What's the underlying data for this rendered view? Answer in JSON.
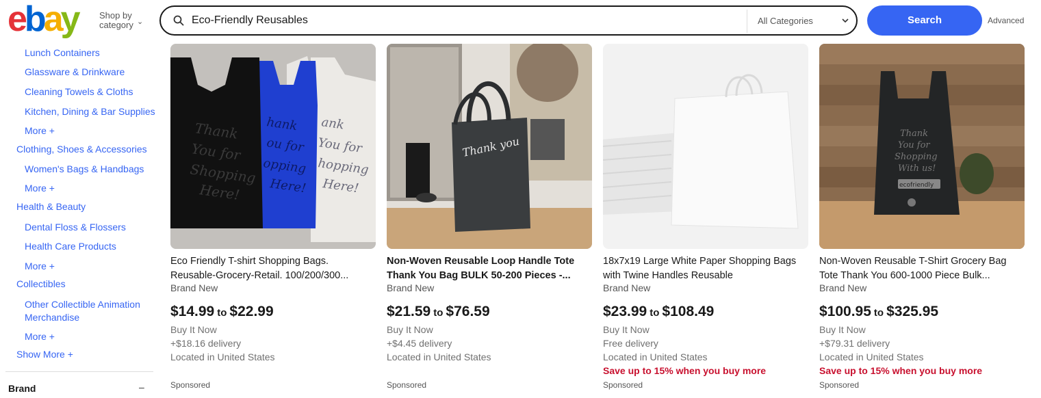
{
  "header": {
    "logo": "ebay",
    "shop_by": "Shop by\ncategory",
    "search_value": "Eco-Friendly Reusables",
    "category_select": "All Categories",
    "search_button": "Search",
    "advanced": "Advanced"
  },
  "sidebar": {
    "items": [
      {
        "label": "Lunch Containers"
      },
      {
        "label": "Glassware & Drinkware"
      },
      {
        "label": "Cleaning Towels & Cloths"
      },
      {
        "label": "Kitchen, Dining & Bar Supplies"
      },
      {
        "label": "More +"
      },
      {
        "label": "Clothing, Shoes & Accessories"
      },
      {
        "label": "Women's Bags & Handbags"
      },
      {
        "label": "More +"
      },
      {
        "label": "Health & Beauty"
      },
      {
        "label": "Dental Floss & Flossers"
      },
      {
        "label": "Health Care Products"
      },
      {
        "label": "More +"
      },
      {
        "label": "Collectibles"
      },
      {
        "label": "Other Collectible Animation Merchandise"
      },
      {
        "label": "More +"
      },
      {
        "label": "Show More +"
      }
    ],
    "brand_heading": "Brand",
    "brand_toggle": "–"
  },
  "products": [
    {
      "title": "Eco Friendly T-shirt Shopping Bags. Reusable-Grocery-Retail. 100/200/300...",
      "condition": "Brand New",
      "price_low": "$14.99",
      "price_to": "to",
      "price_high": "$22.99",
      "format": "Buy It Now",
      "delivery": "+$18.16 delivery",
      "location": "Located in United States",
      "promo": "",
      "sponsored": "Sponsored"
    },
    {
      "title": "Non-Woven Reusable Loop Handle Tote Thank You Bag BULK 50-200 Pieces -...",
      "condition": "Brand New",
      "price_low": "$21.59",
      "price_to": "to",
      "price_high": "$76.59",
      "format": "Buy It Now",
      "delivery": "+$4.45 delivery",
      "location": "Located in United States",
      "promo": "",
      "sponsored": "Sponsored"
    },
    {
      "title": "18x7x19 Large White Paper Shopping Bags with Twine Handles Reusable",
      "condition": "Brand New",
      "price_low": "$23.99",
      "price_to": "to",
      "price_high": "$108.49",
      "format": "Buy It Now",
      "delivery": "Free delivery",
      "location": "Located in United States",
      "promo": "Save up to 15% when you buy more",
      "sponsored": "Sponsored"
    },
    {
      "title": "Non-Woven Reusable T-Shirt Grocery Bag Tote Thank You 600-1000 Piece Bulk...",
      "condition": "Brand New",
      "price_low": "$100.95",
      "price_to": "to",
      "price_high": "$325.95",
      "format": "Buy It Now",
      "delivery": "+$79.31 delivery",
      "location": "Located in United States",
      "promo": "Save up to 15% when you buy more",
      "sponsored": "Sponsored"
    }
  ],
  "image_text": {
    "bag1": "Thank You for Shopping Here!",
    "bag2": "Thank you",
    "bag4": "Thank You for Shopping With us!",
    "bag4_badge": "ecofriendly"
  },
  "colors": {
    "accent": "#3665f3",
    "promo": "#c8102e",
    "link": "#3665f3"
  }
}
